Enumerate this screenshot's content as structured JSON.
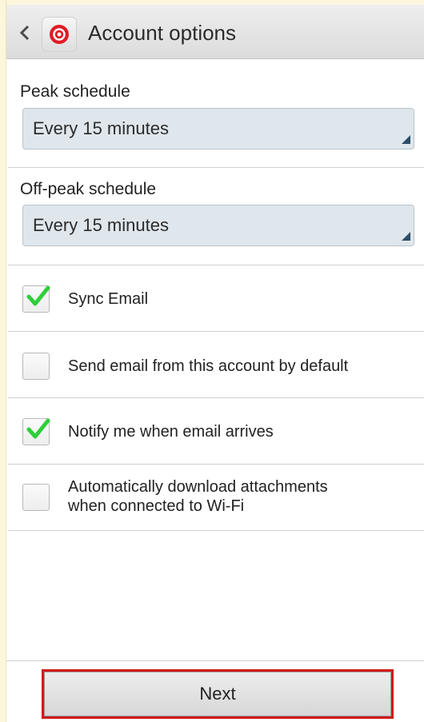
{
  "header": {
    "title": "Account options",
    "back_icon": "chevron-left-icon",
    "app_icon": "email-app-icon"
  },
  "peak_schedule": {
    "label": "Peak schedule",
    "selected": "Every 15 minutes"
  },
  "offpeak_schedule": {
    "label": "Off-peak schedule",
    "selected": "Every 15 minutes"
  },
  "options": [
    {
      "label": "Sync Email",
      "checked": true
    },
    {
      "label": "Send email from this account by default",
      "checked": false
    },
    {
      "label": "Notify me when email arrives",
      "checked": true
    },
    {
      "label_line1": "Automatically download attachments",
      "label_line2": "when connected to Wi-Fi",
      "checked": false
    }
  ],
  "footer": {
    "next_label": "Next"
  },
  "colors": {
    "check": "#2fcf3a",
    "highlight": "#d01a1a",
    "spinner_bg": "#dfe7ed",
    "spinner_arrow": "#2e4d66"
  }
}
